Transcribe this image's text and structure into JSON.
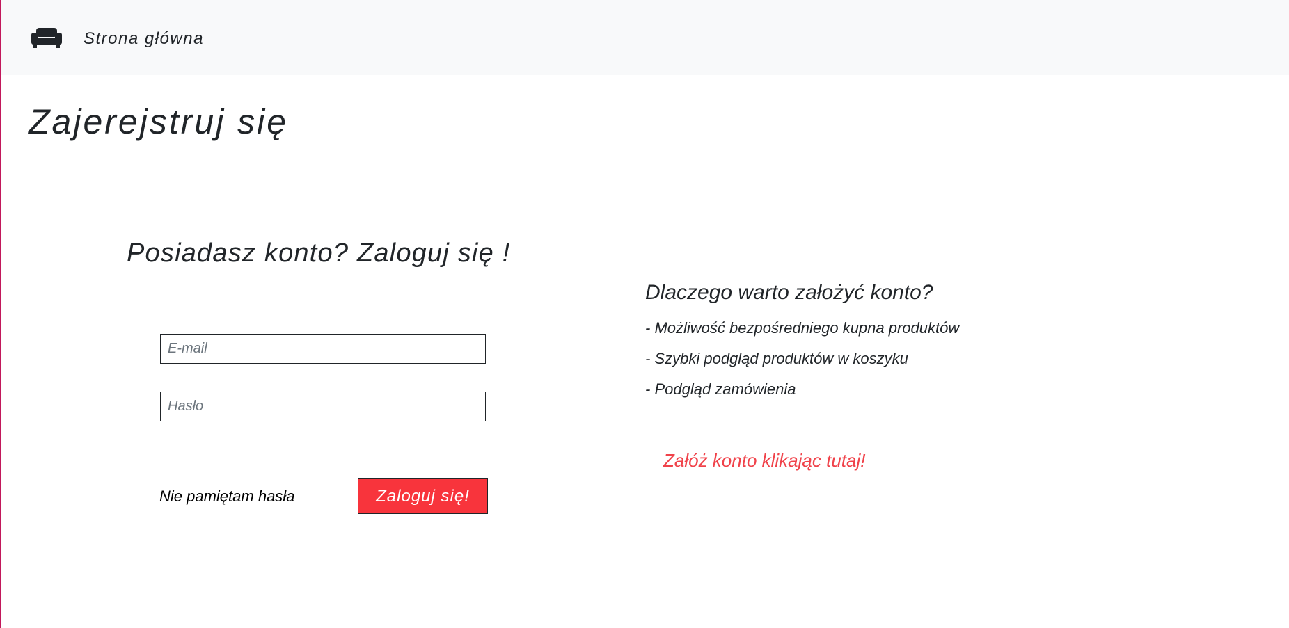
{
  "navbar": {
    "brand_icon": "sofa-icon",
    "home_link": "Strona główna"
  },
  "header": {
    "title": "Zajerejstruj się"
  },
  "login": {
    "heading": "Posiadasz konto? Zaloguj się !",
    "email_placeholder": "E-mail",
    "email_value": "",
    "password_placeholder": "Hasło",
    "password_value": "",
    "forgot_password": "Nie pamiętam hasła",
    "submit_label": "Zaloguj się!"
  },
  "benefits": {
    "heading": "Dlaczego warto założyć konto?",
    "items": [
      "- Możliwość bezpośredniego kupna produktów",
      "- Szybki podgląd produktów w koszyku",
      "- Podgląd zamówienia"
    ],
    "register_link": "Załóż konto klikając tutaj!"
  },
  "colors": {
    "navbar_bg": "#f8f9fa",
    "button_bg": "#f8343c",
    "link_accent": "#f0424a",
    "text": "#212529"
  }
}
